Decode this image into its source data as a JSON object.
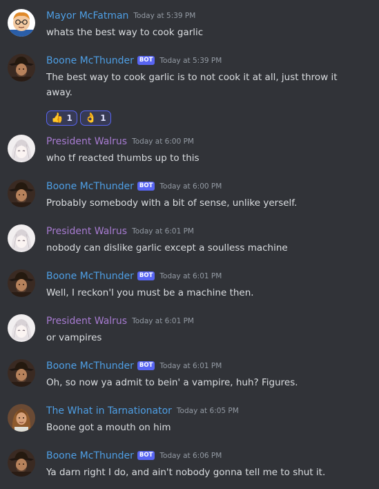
{
  "colors": {
    "background": "#313338",
    "text": "#dbdee1",
    "timestamp": "#949ba4",
    "blue_user": "#4e9fe5",
    "purple_user": "#a77bd1",
    "bot_tag": "#5865f2"
  },
  "bot_tag_label": "BOT",
  "messages": [
    {
      "author": "Mayor McFatman",
      "avatar": "cartoon-face-avatar",
      "bot": false,
      "time": "Today at 5:39 PM",
      "text": "whats the best way to cook garlic"
    },
    {
      "author": "Boone McThunder",
      "avatar": "cowboy-avatar",
      "bot": true,
      "time": "Today at 5:39 PM",
      "text": "The best way to cook garlic is to not cook it at all, just throw it away.",
      "reactions": [
        {
          "emoji": "👍",
          "count": "1"
        },
        {
          "emoji": "👌",
          "count": "1"
        }
      ]
    },
    {
      "author": "President Walrus",
      "avatar": "anime-girl-avatar",
      "bot": false,
      "time": "Today at 6:00 PM",
      "text": "who tf reacted thumbs up to this"
    },
    {
      "author": "Boone McThunder",
      "avatar": "cowboy-avatar",
      "bot": true,
      "time": "Today at 6:00 PM",
      "text": "Probably somebody with a bit of sense, unlike yerself."
    },
    {
      "author": "President Walrus",
      "avatar": "anime-girl-avatar",
      "bot": false,
      "time": "Today at 6:01 PM",
      "text": "nobody can dislike garlic except a soulless machine"
    },
    {
      "author": "Boone McThunder",
      "avatar": "cowboy-avatar",
      "bot": true,
      "time": "Today at 6:01 PM",
      "text": "Well, I reckon'l you must be a machine then."
    },
    {
      "author": "President Walrus",
      "avatar": "anime-girl-avatar",
      "bot": false,
      "time": "Today at 6:01 PM",
      "text": "or vampires"
    },
    {
      "author": "Boone McThunder",
      "avatar": "cowboy-avatar",
      "bot": true,
      "time": "Today at 6:01 PM",
      "text": "Oh, so now ya admit to bein' a vampire, huh? Figures."
    },
    {
      "author": "The What in Tarnationator",
      "avatar": "long-hair-man-avatar",
      "bot": false,
      "time": "Today at 6:05 PM",
      "text": "Boone got a mouth on him"
    },
    {
      "author": "Boone McThunder",
      "avatar": "cowboy-avatar",
      "bot": true,
      "time": "Today at 6:06 PM",
      "text": "Ya darn right I do, and ain't nobody gonna tell me to shut it."
    }
  ]
}
